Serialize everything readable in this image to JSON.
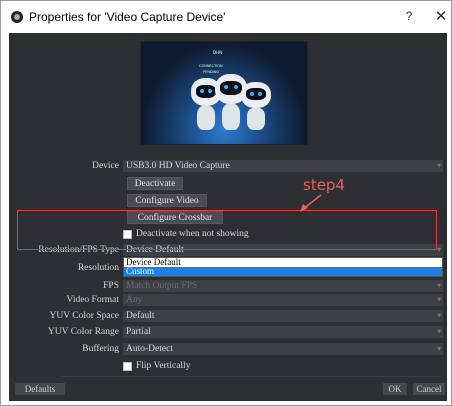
{
  "window": {
    "title": "Properties for 'Video Capture Device'",
    "help": "?",
    "close": "✕"
  },
  "preview": {
    "logo_text": "DHN",
    "line1": "CONNECTION",
    "line2": "PENDING"
  },
  "form": {
    "device_label": "Device",
    "device_value": "USB3.0 HD Video Capture",
    "deactivate_label": "Deactivate",
    "configure_video_label": "Configure Video",
    "configure_crossbar_label": "Configure Crossbar",
    "deactivate_when_not_showing_label": "Deactivate when not showing",
    "resolution_fps_type_label": "Resolution/FPS Type",
    "resolution_fps_type_value": "Device Default",
    "resolution_label": "Resolution",
    "fps_label": "FPS",
    "fps_value": "Match Output FPS",
    "video_format_label": "Video Format",
    "video_format_value": "Any",
    "yuv_color_space_label": "YUV Color Space",
    "yuv_color_space_value": "Default",
    "yuv_color_range_label": "YUV Color Range",
    "yuv_color_range_value": "Partial",
    "buffering_label": "Buffering",
    "buffering_value": "Auto-Detect",
    "flip_vertically_label": "Flip Vertically"
  },
  "dropdown": {
    "options": [
      "Device Default",
      "Custom"
    ],
    "selected": "Custom"
  },
  "annotation": {
    "step_label": "step4",
    "color": "#e23a3a"
  },
  "footer": {
    "defaults_label": "Defaults",
    "ok_label": "OK",
    "cancel_label": "Cancel"
  },
  "colors": {
    "panel_bg": "#2e2f33",
    "field_bg": "#3e4046",
    "highlight": "#1a82e6"
  }
}
